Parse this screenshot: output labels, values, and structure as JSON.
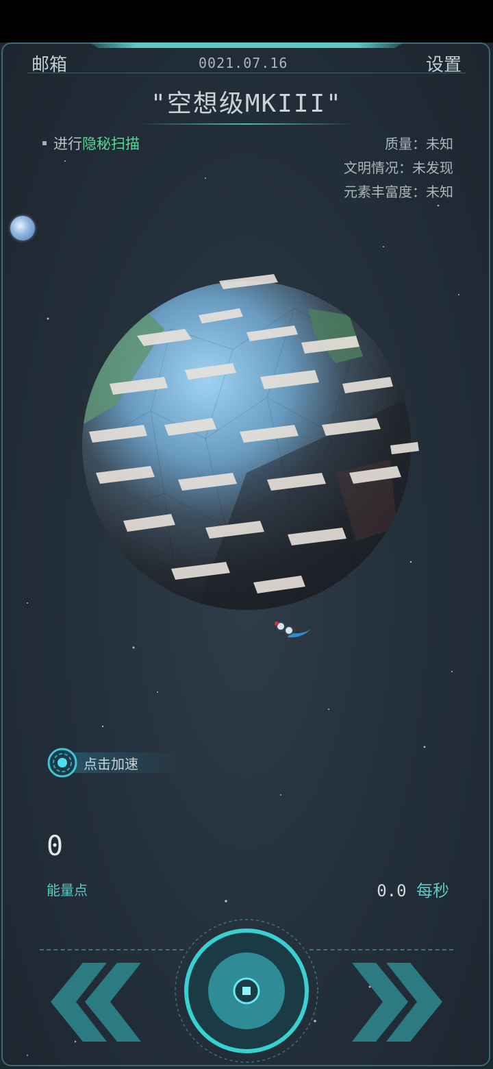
{
  "header": {
    "mail_label": "邮箱",
    "date": "0021.07.16",
    "settings_label": "设置"
  },
  "planet": {
    "name": "\"空想级MKIII\"",
    "scan_prefix": "进行",
    "scan_action": "隐秘扫描",
    "info": [
      "质量：未知",
      "文明情况：未发现",
      "元素丰富度：未知"
    ]
  },
  "boost": {
    "label": "点击加速"
  },
  "energy": {
    "value": "0",
    "label": "能量点",
    "rate": "0.0",
    "rate_unit": "每秒"
  },
  "icons": {
    "prev": "double-chevron-left-icon",
    "next": "double-chevron-right-icon",
    "center": "circular-action-icon"
  },
  "colors": {
    "accent_cyan": "#59c9c9",
    "scan_green": "#56d79d",
    "background": "#24303b"
  }
}
